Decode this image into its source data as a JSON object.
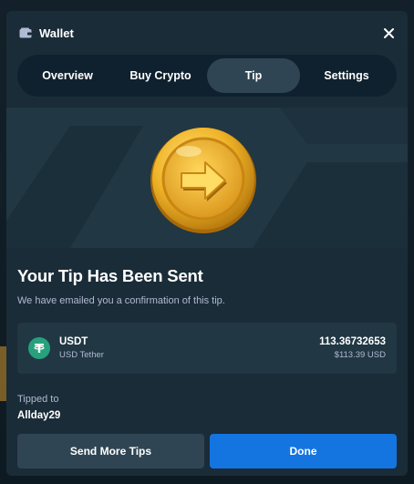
{
  "header": {
    "title": "Wallet",
    "icon": "wallet-icon",
    "close_icon": "close-icon"
  },
  "tabs": [
    {
      "label": "Overview",
      "active": false
    },
    {
      "label": "Buy Crypto",
      "active": false
    },
    {
      "label": "Tip",
      "active": true
    },
    {
      "label": "Settings",
      "active": false
    }
  ],
  "hero": {
    "icon": "arrow-coin-icon"
  },
  "content": {
    "title": "Your Tip Has Been Sent",
    "subtitle": "We have emailed you a confirmation of this tip."
  },
  "asset": {
    "icon": "usdt-icon",
    "symbol": "USDT",
    "name": "USD Tether",
    "amount": "113.36732653",
    "fiat": "$113.39 USD"
  },
  "recipient": {
    "label": "Tipped to",
    "username": "Allday29"
  },
  "actions": {
    "secondary_label": "Send More Tips",
    "primary_label": "Done"
  },
  "colors": {
    "modal_bg": "#1a2c38",
    "card_bg": "#213743",
    "tab_active": "#2f4553",
    "primary": "#1475e1",
    "usdt": "#26a17b",
    "muted_text": "#b1bad3"
  }
}
